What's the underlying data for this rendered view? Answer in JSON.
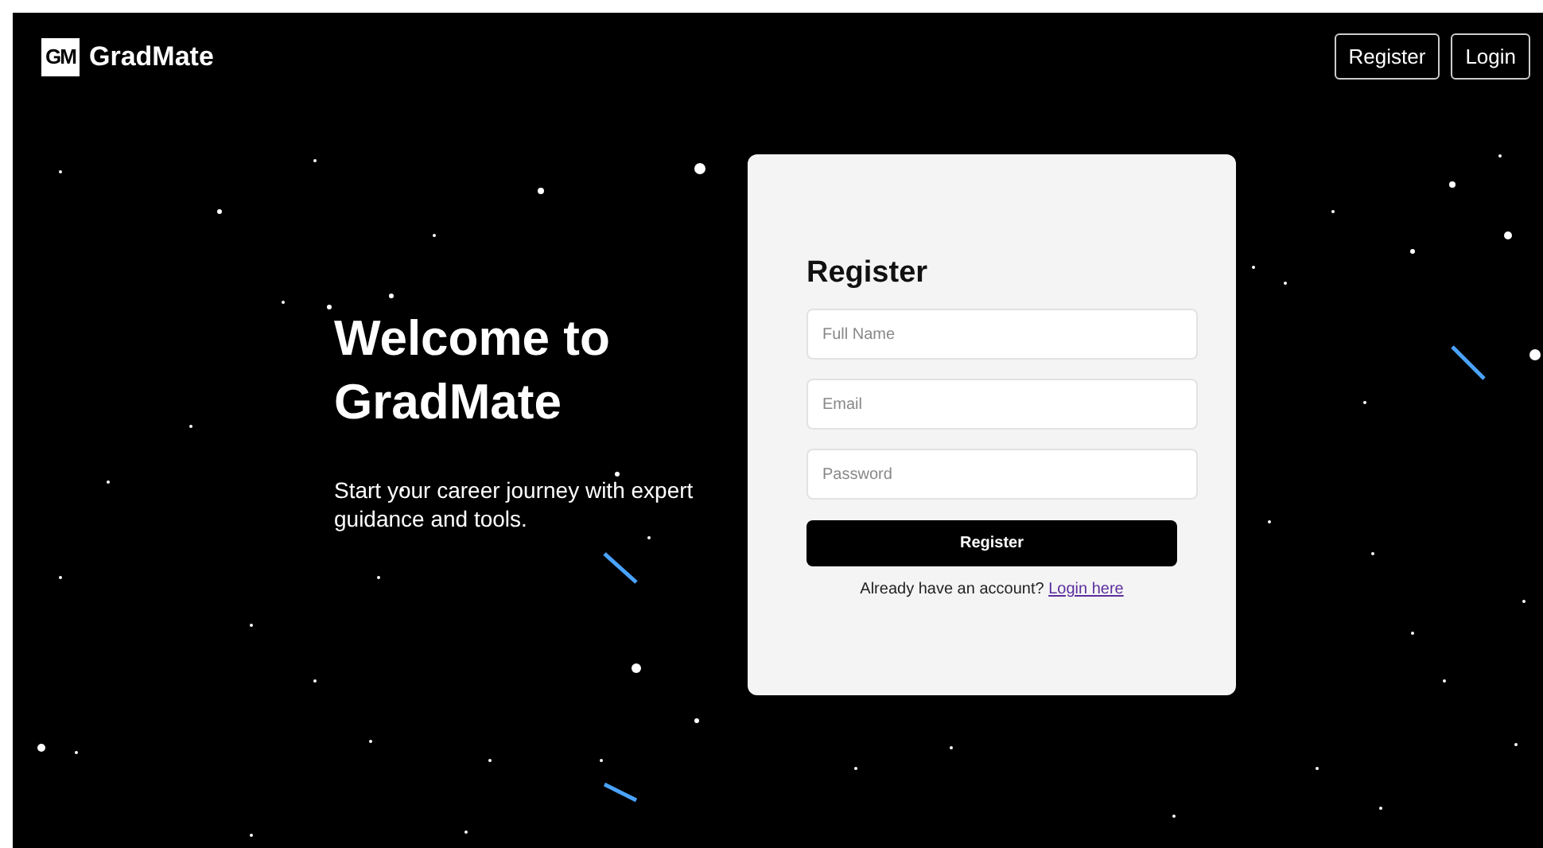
{
  "brand": {
    "logo": "GM",
    "name": "GradMate"
  },
  "nav": [
    {
      "label": "Register"
    },
    {
      "label": "Login"
    }
  ],
  "hero": {
    "title": "Welcome to GradMate",
    "subtitle": "Start your career journey with expert guidance and tools."
  },
  "form": {
    "title": "Register",
    "fields": [
      {
        "placeholder": "Full Name"
      },
      {
        "placeholder": "Email"
      },
      {
        "placeholder": "Password"
      }
    ],
    "submit": "Register",
    "prompt": "Already have an account?",
    "link": "Login here"
  }
}
